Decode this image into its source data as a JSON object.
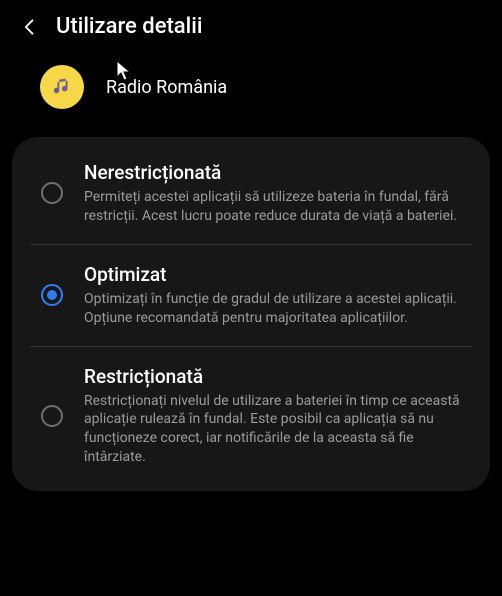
{
  "header": {
    "title": "Utilizare detalii"
  },
  "app": {
    "name": "Radio România"
  },
  "options": [
    {
      "title": "Nerestricționată",
      "desc": "Permiteți acestei aplicații să utilizeze bateria în fundal, fără restricții. Acest lucru poate reduce durata de viață a bateriei.",
      "selected": false
    },
    {
      "title": "Optimizat",
      "desc": "Optimizați în funcție de gradul de utilizare a acestei aplicații. Opțiune recomandată pentru majoritatea aplicațiilor.",
      "selected": true
    },
    {
      "title": "Restricționată",
      "desc": "Restricționați nivelul de utilizare a bateriei în timp ce această aplicație rulează în fundal. Este posibil ca aplicația să nu funcționeze corect, iar notificările de la aceasta să fie întârziate.",
      "selected": false
    }
  ]
}
